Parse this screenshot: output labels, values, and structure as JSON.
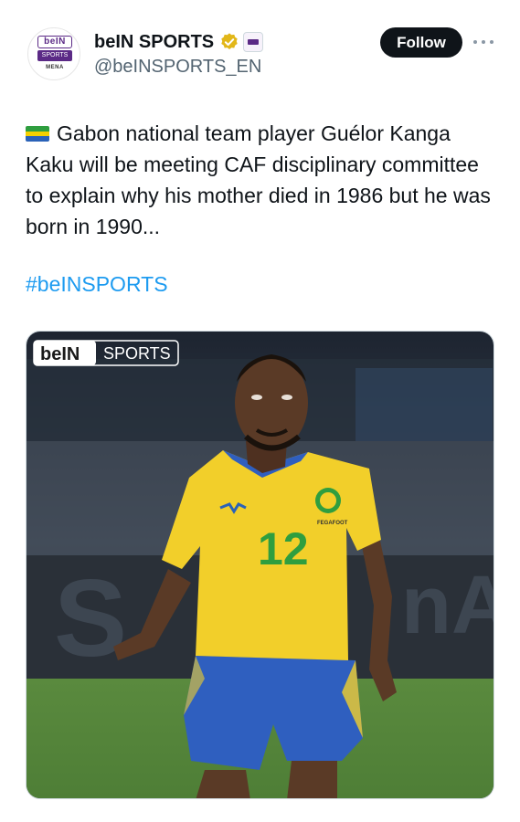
{
  "account": {
    "display_name": "beIN SPORTS",
    "handle": "@beINSPORTS_EN",
    "avatar": {
      "logo_word": "beIN",
      "logo_sub": "SPORTS",
      "region": "MENA"
    },
    "verified_icon": "gold-verified-badge-icon",
    "affiliate_icon": "affiliate-badge-icon"
  },
  "actions": {
    "follow_label": "Follow",
    "more_icon": "more-options-icon"
  },
  "tweet": {
    "flag_icon": "gabon-flag-icon",
    "text": "Gabon national team player Guélor Kanga Kaku will be meeting CAF disciplinary committee to explain why his mother died in 1986 but he was born in 1990...",
    "hashtag": "#beINSPORTS"
  },
  "media": {
    "watermark_word": "beIN",
    "watermark_sub": "SPORTS",
    "jersey_number": "12",
    "jersey_crest_text": "FEGAFOOT"
  },
  "colors": {
    "link": "#1d9bf0",
    "follow_bg": "#0f1419",
    "brand_purple": "#5b2a86",
    "jersey_yellow": "#f2cf2a",
    "shorts_blue": "#2f5fbf",
    "flag_green": "#2f9e3f",
    "flag_yellow": "#f5d000",
    "flag_blue": "#2a62b8"
  }
}
